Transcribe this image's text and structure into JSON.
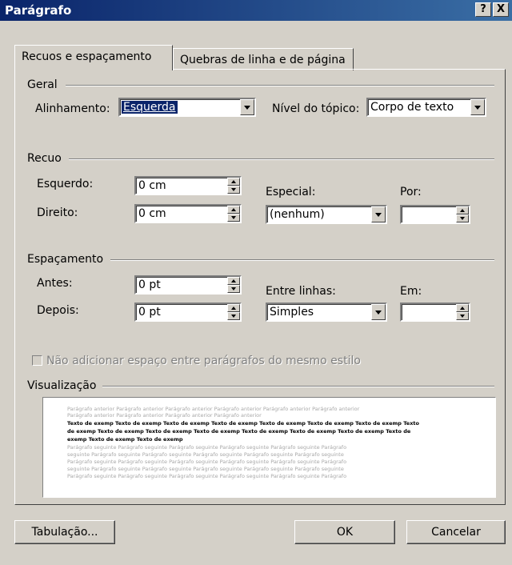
{
  "window": {
    "title": "Parágrafo",
    "help_label": "?",
    "close_label": "X"
  },
  "tabs": [
    {
      "label": "Recuos e espaçamento",
      "active": true
    },
    {
      "label": "Quebras de linha e de página",
      "active": false
    }
  ],
  "general": {
    "section_label": "Geral",
    "alignment_label": "Alinhamento:",
    "alignment_value": "Esquerda",
    "outline_label": "Nível do tópico:",
    "outline_value": "Corpo de texto"
  },
  "indent": {
    "section_label": "Recuo",
    "left_label": "Esquerdo:",
    "left_value": "0 cm",
    "right_label": "Direito:",
    "right_value": "0 cm",
    "special_label": "Especial:",
    "special_value": "(nenhum)",
    "by_label": "Por:",
    "by_value": ""
  },
  "spacing": {
    "section_label": "Espaçamento",
    "before_label": "Antes:",
    "before_value": "0 pt",
    "after_label": "Depois:",
    "after_value": "0 pt",
    "line_label": "Entre linhas:",
    "line_value": "Simples",
    "at_label": "Em:",
    "at_value": ""
  },
  "checkbox": {
    "label": "Não adicionar espaço entre parágrafos do mesmo estilo",
    "checked": false,
    "enabled": false
  },
  "preview": {
    "section_label": "Visualização",
    "lines": [
      {
        "text": "Parágrafo anterior Parágrafo anterior Parágrafo anterior Parágrafo anterior Parágrafo anterior Parágrafo anterior",
        "style": "gray"
      },
      {
        "text": "Parágrafo anterior Parágrafo anterior Parágrafo anterior Parágrafo anterior",
        "style": "gray"
      },
      {
        "text": "Texto de exemp Texto de exemp Texto de exemp Texto de exemp Texto de exemp Texto de exemp Texto de exemp Texto",
        "style": "black"
      },
      {
        "text": "de exemp Texto de exemp Texto de exemp Texto de exemp Texto de exemp Texto de exemp Texto de exemp Texto de",
        "style": "black"
      },
      {
        "text": "exemp Texto de exemp Texto de exemp",
        "style": "black"
      },
      {
        "text": "Parágrafo seguinte Parágrafo seguinte Parágrafo seguinte Parágrafo seguinte Parágrafo seguinte Parágrafo",
        "style": "gray"
      },
      {
        "text": "seguinte Parágrafo seguinte Parágrafo seguinte Parágrafo seguinte Parágrafo seguinte Parágrafo seguinte",
        "style": "gray"
      },
      {
        "text": "Parágrafo seguinte Parágrafo seguinte Parágrafo seguinte Parágrafo seguinte Parágrafo seguinte Parágrafo",
        "style": "gray"
      },
      {
        "text": "seguinte Parágrafo seguinte Parágrafo seguinte Parágrafo seguinte Parágrafo seguinte Parágrafo seguinte",
        "style": "gray"
      },
      {
        "text": "Parágrafo seguinte Parágrafo seguinte Parágrafo seguinte Parágrafo seguinte Parágrafo seguinte Parágrafo",
        "style": "gray"
      }
    ]
  },
  "buttons": {
    "tabs_label": "Tabulação...",
    "ok_label": "OK",
    "cancel_label": "Cancelar"
  }
}
